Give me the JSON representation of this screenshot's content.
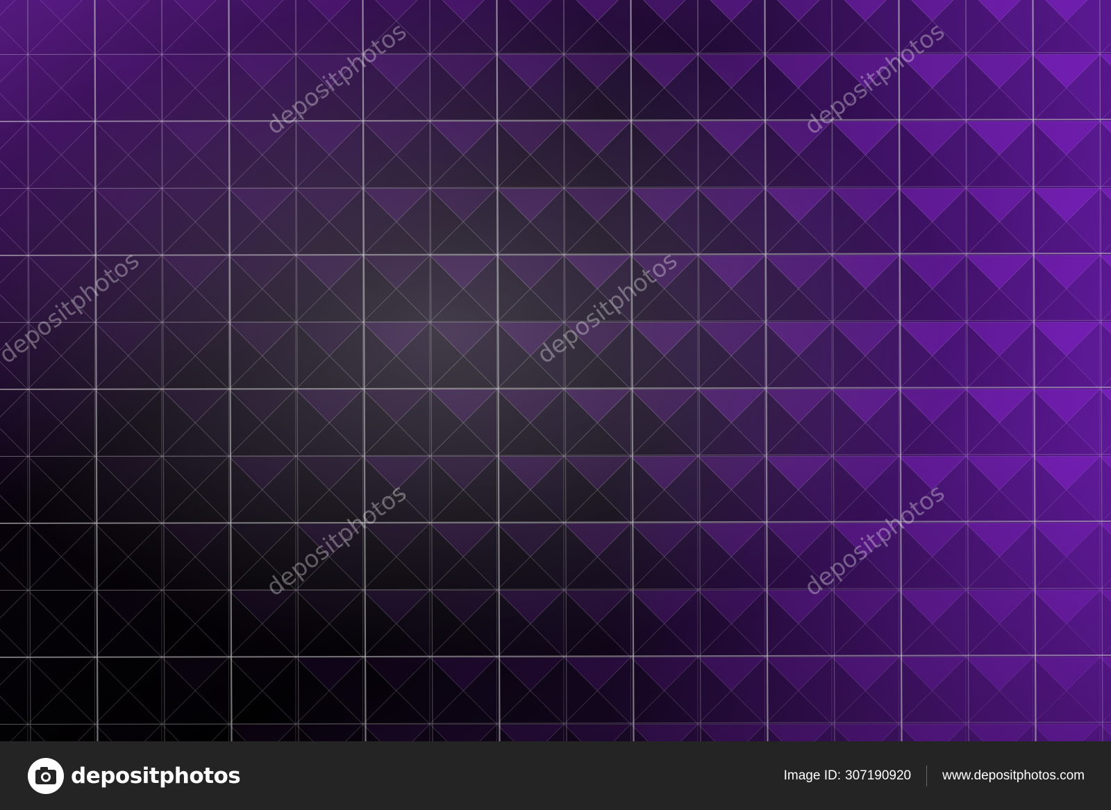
{
  "photo": {
    "subject": "pyramid-tile-wall",
    "colors": {
      "light": "#c9c9c9",
      "mid": "#8a8a8a",
      "dark": "#3a3838",
      "shadow": "#262428",
      "violet": "#9a2ee6",
      "violet_deep": "#4a1d7d",
      "grout": "#cfd2cf"
    }
  },
  "watermark": {
    "text": "depositphotos",
    "color": "#ffffff"
  },
  "footer": {
    "brand": "depositphotos",
    "image_id_label": "Image ID:",
    "image_id": "307190920",
    "site_url": "www.depositphotos.com",
    "logo_icon": "camera-icon",
    "background": "#242424"
  }
}
